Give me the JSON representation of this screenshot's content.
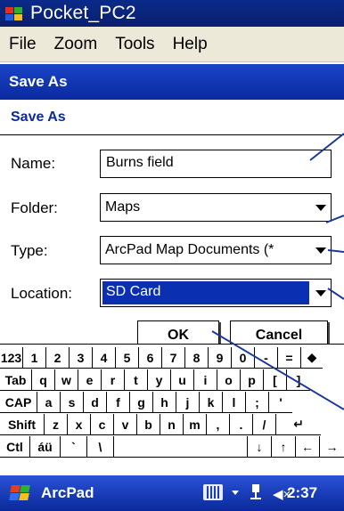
{
  "window": {
    "title": "Pocket_PC2",
    "menu": [
      "File",
      "Zoom",
      "Tools",
      "Help"
    ]
  },
  "navbar": {
    "title": "Save As"
  },
  "dialog": {
    "heading": "Save As",
    "name_label": "Name:",
    "name_value": "Burns field",
    "folder_label": "Folder:",
    "folder_value": "Maps",
    "type_label": "Type:",
    "type_value": "ArcPad Map Documents (*",
    "location_label": "Location:",
    "location_value": "SD Card",
    "ok_label": "OK",
    "cancel_label": "Cancel"
  },
  "keyboard": {
    "rows": [
      [
        "123",
        "1",
        "2",
        "3",
        "4",
        "5",
        "6",
        "7",
        "8",
        "9",
        "0",
        "-",
        "=",
        "◆"
      ],
      [
        "Tab",
        "q",
        "w",
        "e",
        "r",
        "t",
        "y",
        "u",
        "i",
        "o",
        "p",
        "[",
        "]"
      ],
      [
        "CAP",
        "a",
        "s",
        "d",
        "f",
        "g",
        "h",
        "j",
        "k",
        "l",
        ";",
        "'"
      ],
      [
        "Shift",
        "z",
        "x",
        "c",
        "v",
        "b",
        "n",
        "m",
        ",",
        ".",
        "/",
        "↵"
      ],
      [
        "Ctl",
        "áü",
        "`",
        "\\",
        "",
        "↓",
        "↑",
        "←",
        "→"
      ]
    ]
  },
  "taskbar": {
    "app_name": "ArcPad",
    "time": "2:37",
    "start_icon": "windows-flag-icon",
    "input_icon": "keyboard-icon",
    "connectivity_icon": "network-icon",
    "volume_icon": "speaker-icon"
  },
  "colors": {
    "title_bar": "#0a246a",
    "nav_bar": "#0a2fb0",
    "selection": "#0a2fb0",
    "heading_text": "#0a2aa0",
    "callout_line": "#1a3a9a"
  }
}
